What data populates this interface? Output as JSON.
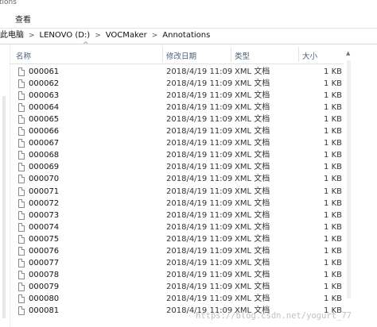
{
  "window": {
    "title_fragment": "tions"
  },
  "ribbon": {
    "tab_view": "查看"
  },
  "address": {
    "segments": [
      "此电脑",
      "LENOVO (D:)",
      "VOCMaker",
      "Annotations"
    ],
    "separator": ">"
  },
  "columns": {
    "name": "名称",
    "modified": "修改日期",
    "type": "类型",
    "size": "大小"
  },
  "files": [
    {
      "name": "000061",
      "modified": "2018/4/19 11:09",
      "type": "XML 文档",
      "size": "1 KB"
    },
    {
      "name": "000062",
      "modified": "2018/4/19 11:09",
      "type": "XML 文档",
      "size": "1 KB"
    },
    {
      "name": "000063",
      "modified": "2018/4/19 11:09",
      "type": "XML 文档",
      "size": "1 KB"
    },
    {
      "name": "000064",
      "modified": "2018/4/19 11:09",
      "type": "XML 文档",
      "size": "1 KB"
    },
    {
      "name": "000065",
      "modified": "2018/4/19 11:09",
      "type": "XML 文档",
      "size": "1 KB"
    },
    {
      "name": "000066",
      "modified": "2018/4/19 11:09",
      "type": "XML 文档",
      "size": "1 KB"
    },
    {
      "name": "000067",
      "modified": "2018/4/19 11:09",
      "type": "XML 文档",
      "size": "1 KB"
    },
    {
      "name": "000068",
      "modified": "2018/4/19 11:09",
      "type": "XML 文档",
      "size": "1 KB"
    },
    {
      "name": "000069",
      "modified": "2018/4/19 11:09",
      "type": "XML 文档",
      "size": "1 KB"
    },
    {
      "name": "000070",
      "modified": "2018/4/19 11:09",
      "type": "XML 文档",
      "size": "1 KB"
    },
    {
      "name": "000071",
      "modified": "2018/4/19 11:09",
      "type": "XML 文档",
      "size": "1 KB"
    },
    {
      "name": "000072",
      "modified": "2018/4/19 11:09",
      "type": "XML 文档",
      "size": "1 KB"
    },
    {
      "name": "000073",
      "modified": "2018/4/19 11:09",
      "type": "XML 文档",
      "size": "1 KB"
    },
    {
      "name": "000074",
      "modified": "2018/4/19 11:09",
      "type": "XML 文档",
      "size": "1 KB"
    },
    {
      "name": "000075",
      "modified": "2018/4/19 11:09",
      "type": "XML 文档",
      "size": "1 KB"
    },
    {
      "name": "000076",
      "modified": "2018/4/19 11:09",
      "type": "XML 文档",
      "size": "1 KB"
    },
    {
      "name": "000077",
      "modified": "2018/4/19 11:09",
      "type": "XML 文档",
      "size": "1 KB"
    },
    {
      "name": "000078",
      "modified": "2018/4/19 11:09",
      "type": "XML 文档",
      "size": "1 KB"
    },
    {
      "name": "000079",
      "modified": "2018/4/19 11:09",
      "type": "XML 文档",
      "size": "1 KB"
    },
    {
      "name": "000080",
      "modified": "2018/4/19 11:09",
      "type": "XML 文档",
      "size": "1 KB"
    },
    {
      "name": "000081",
      "modified": "2018/4/19 11:09",
      "type": "XML 文档",
      "size": "1 KB"
    }
  ],
  "watermark": "https://blog.csdn.net/yogurt_77"
}
